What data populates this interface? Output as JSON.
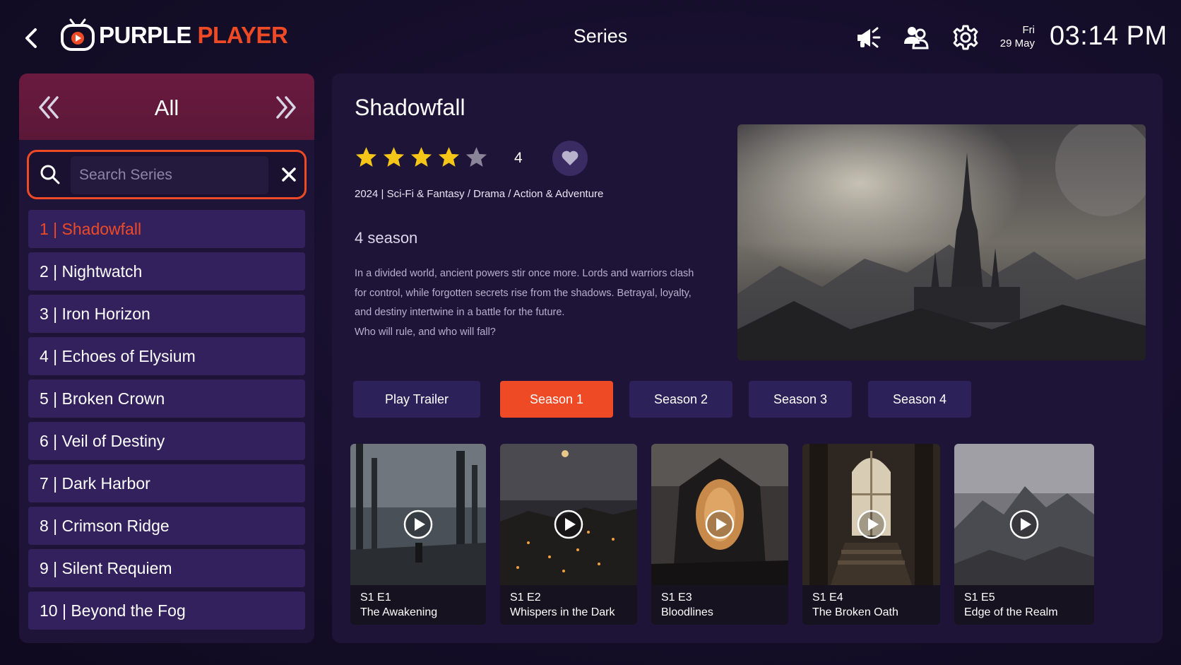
{
  "header": {
    "logo_word1": "PURPLE",
    "logo_word2": "PLAYER",
    "title": "Series",
    "day": "Fri",
    "date": "29 May",
    "time": "03:14 PM"
  },
  "category": {
    "title": "All"
  },
  "search": {
    "placeholder": "Search Series",
    "value": ""
  },
  "series": [
    {
      "label": "1 | Shadowfall",
      "active": true
    },
    {
      "label": "2 | Nightwatch",
      "active": false
    },
    {
      "label": "3 | Iron Horizon",
      "active": false
    },
    {
      "label": "4 | Echoes of Elysium",
      "active": false
    },
    {
      "label": "5 | Broken Crown",
      "active": false
    },
    {
      "label": "6 | Veil of Destiny",
      "active": false
    },
    {
      "label": "7 | Dark Harbor",
      "active": false
    },
    {
      "label": "8 | Crimson Ridge",
      "active": false
    },
    {
      "label": "9 | Silent Requiem",
      "active": false
    },
    {
      "label": "10 | Beyond the Fog",
      "active": false
    }
  ],
  "details": {
    "title": "Shadowfall",
    "rating": "4",
    "stars_filled": 4,
    "stars_total": 5,
    "meta": "2024 | Sci-Fi & Fantasy / Drama / Action & Adventure",
    "seasons_count": "4 season",
    "description": [
      "In a divided world, ancient powers stir once more. Lords and warriors clash",
      "for control, while forgotten secrets rise from the shadows. Betrayal, loyalty,",
      "and destiny intertwine in a battle for the future.",
      "Who will rule, and who will fall?"
    ]
  },
  "buttons": {
    "trailer": "Play Trailer",
    "seasons": [
      "Season 1",
      "Season 2",
      "Season 3",
      "Season 4"
    ],
    "active_season": 0
  },
  "episodes": [
    {
      "code": "S1 E1",
      "title": "The Awakening"
    },
    {
      "code": "S1 E2",
      "title": "Whispers in the Dark"
    },
    {
      "code": "S1 E3",
      "title": "Bloodlines"
    },
    {
      "code": "S1 E4",
      "title": "The Broken Oath"
    },
    {
      "code": "S1 E5",
      "title": "Edge of the Realm"
    }
  ],
  "colors": {
    "accent": "#ef4a26",
    "panel": "#1e1438",
    "list_item": "#33215e",
    "button": "#2c2158",
    "star_filled": "#f5c518",
    "star_empty": "#8a8599"
  },
  "icons": {
    "back": "chevron-left-icon",
    "announcement": "megaphone-icon",
    "profiles": "users-icon",
    "settings": "gear-icon",
    "favorite": "heart-icon",
    "play": "play-icon"
  }
}
